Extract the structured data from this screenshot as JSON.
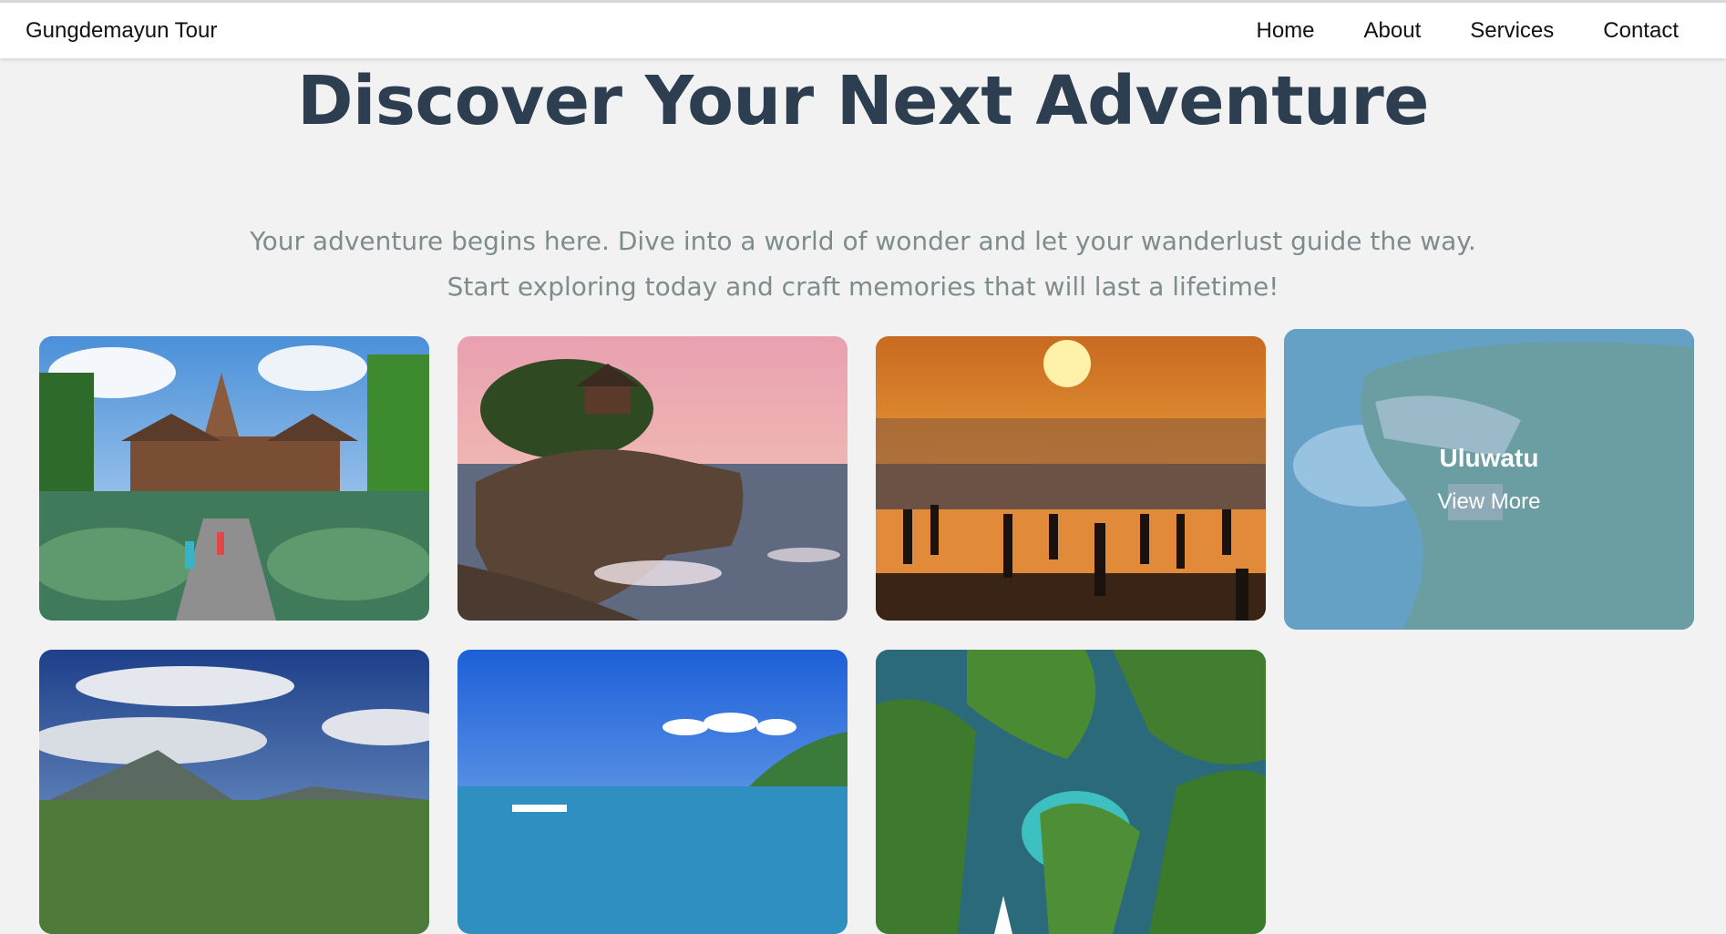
{
  "nav": {
    "brand": "Gungdemayun Tour",
    "links": [
      "Home",
      "About",
      "Services",
      "Contact"
    ]
  },
  "hero": {
    "title": "Discover Your Next Adventure",
    "subtitle_line1": "Your adventure begins here. Dive into a world of wonder and let your wanderlust guide the way.",
    "subtitle_line2": "Start exploring today and craft memories that will last a lifetime!"
  },
  "cards": [
    {
      "image": "temple-garden-photo"
    },
    {
      "image": "sea-temple-rock-photo"
    },
    {
      "image": "beach-sunset-silhouettes-photo"
    },
    {
      "image": "cliff-coast-photo",
      "title": "Uluwatu",
      "link": "View More"
    },
    {
      "image": "volcano-landscape-photo"
    },
    {
      "image": "ocean-boat-photo"
    },
    {
      "image": "green-island-cliffs-photo"
    }
  ]
}
